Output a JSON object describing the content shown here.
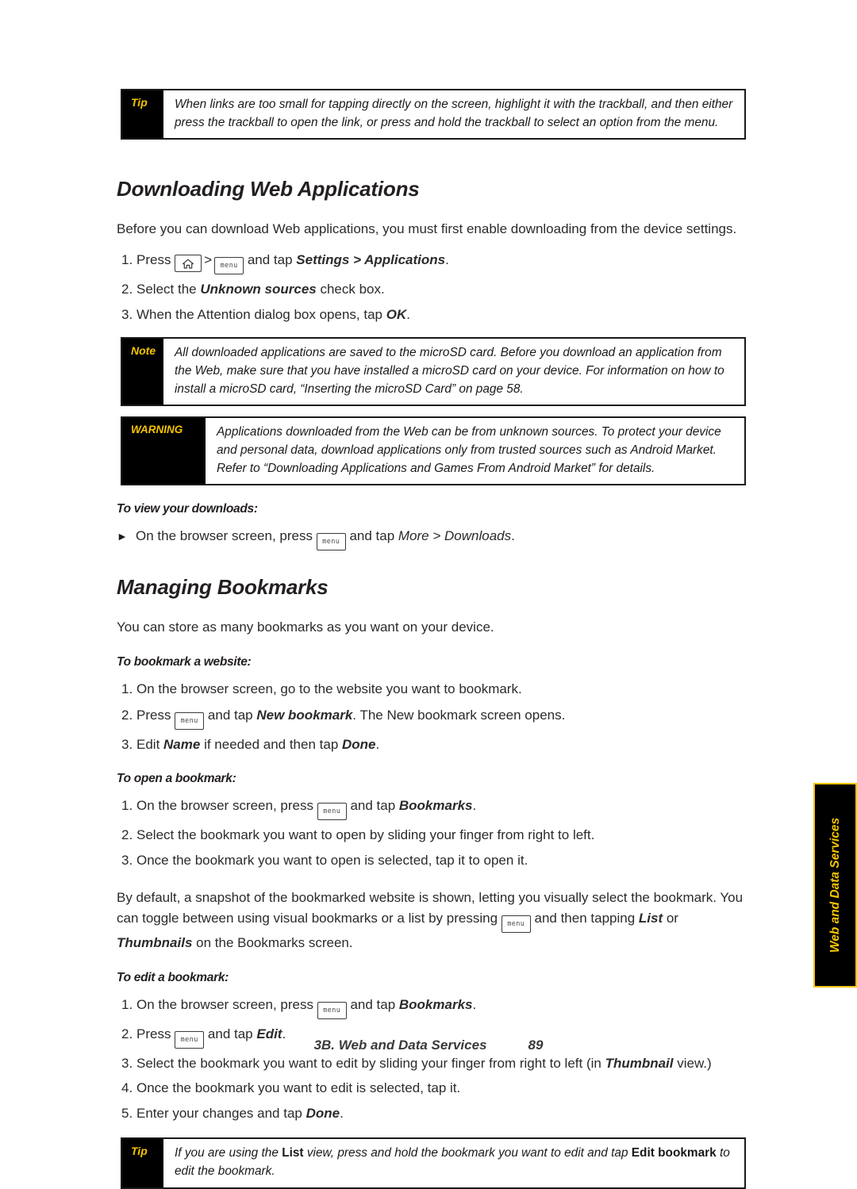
{
  "document": {
    "footer": {
      "chapter": "3B. Web and Data Services",
      "page_number": "89"
    },
    "side_tab": {
      "label": "Web and Data Services",
      "background": "#000000",
      "border_color": "#f5c400",
      "text_color": "#f5c400"
    }
  },
  "callouts": {
    "tip_top": {
      "label": "Tip",
      "line1": "When links are too small for tapping directly on the screen, highlight it with the trackball, and then either press the",
      "line2": "trackball to open the link, or press and hold the trackball to select an option from the menu."
    },
    "note": {
      "label": "Note",
      "line1": "All downloaded applications are saved to the microSD card. Before you download an application from the Web,",
      "line2": "make sure that you have installed a microSD card on your device. For information on how to install a microSD",
      "line3": "card, “Inserting the microSD Card” on page 58."
    },
    "warning": {
      "label": "WARNING",
      "line1": "Applications downloaded from the Web can be from unknown sources. To protect your device and",
      "line2": "personal data, download applications only from trusted sources such as Android Market. Refer to",
      "line3": "“Downloading Applications and Games From Android Market” for details."
    },
    "tip_bottom": {
      "label": "Tip",
      "line1_a": "If you are using the ",
      "line1_list": "List",
      "line1_b": " view, press and hold the bookmark you want to edit and tap ",
      "line1_edit": "Edit bookmark",
      "line1_c": " to edit the",
      "line2": "bookmark."
    }
  },
  "sections": {
    "downloading": {
      "title": "Downloading Web Applications",
      "intro": "Before you can download Web applications, you must first enable downloading from the device settings.",
      "steps": [
        {
          "num": "1.",
          "pre": "Press ",
          "mid": " and tap ",
          "emph": "Settings > Applications",
          "post": "."
        },
        {
          "num": "2.",
          "pre": "Select the ",
          "emph": "Unknown sources",
          "post": " check box."
        },
        {
          "num": "3.",
          "pre": "When the Attention dialog box opens, tap ",
          "emph": "OK",
          "post": "."
        }
      ],
      "view_downloads": {
        "heading": "To view your downloads:",
        "pre": "On the browser screen, press ",
        "mid": " and tap ",
        "emph": "More > Downloads",
        "post": "."
      }
    },
    "bookmarks": {
      "title": "Managing Bookmarks",
      "intro": "You can store as many bookmarks as you want on your device.",
      "to_bookmark": {
        "heading": "To bookmark a website:",
        "steps": [
          {
            "num": "1.",
            "text": "On the browser screen, go to the website you want to bookmark."
          },
          {
            "num": "2.",
            "pre": "Press ",
            "mid": " and tap ",
            "emph": "New bookmark",
            "post": ". The New bookmark screen opens."
          },
          {
            "num": "3.",
            "pre": "Edit ",
            "emph": "Name",
            "mid2": " if needed and then tap ",
            "emph2": "Done",
            "post": "."
          }
        ]
      },
      "to_open": {
        "heading": "To open a bookmark:",
        "steps": [
          {
            "num": "1.",
            "pre": "On the browser screen, press ",
            "mid": " and tap ",
            "emph": "Bookmarks",
            "post": "."
          },
          {
            "num": "2.",
            "text": "Select the bookmark you want to open by sliding your finger from right to left."
          },
          {
            "num": "3.",
            "text": "Once the bookmark you want to open is selected, tap it to open it."
          }
        ]
      },
      "toggle_paragraph": {
        "part1": "By default, a snapshot of the bookmarked website is shown, letting you visually select the bookmark. You can toggle between using visual bookmarks or a list by pressing ",
        "part2": " and then tapping ",
        "emph_list": "List",
        "part3": " or ",
        "emph_thumbnails": "Thumbnails",
        "part4": " on the Bookmarks screen."
      },
      "to_edit": {
        "heading": "To edit a bookmark:",
        "steps": [
          {
            "num": "1.",
            "pre": "On the browser screen, press ",
            "mid": " and tap ",
            "emph": "Bookmarks",
            "post": "."
          },
          {
            "num": "2.",
            "pre": "Press ",
            "mid": " and tap ",
            "emph": "Edit",
            "post": "."
          },
          {
            "num": "3.",
            "pre": "Select the bookmark you want to edit by sliding your finger from right to left (in ",
            "emph": "Thumbnail",
            "post": " view.)"
          },
          {
            "num": "4.",
            "text": "Once the bookmark you want to edit is selected, tap it."
          },
          {
            "num": "5.",
            "pre": "Enter your changes and tap ",
            "emph": "Done",
            "post": "."
          }
        ]
      }
    }
  },
  "keys": {
    "menu_label": "menu",
    "home_label": "home-key"
  }
}
